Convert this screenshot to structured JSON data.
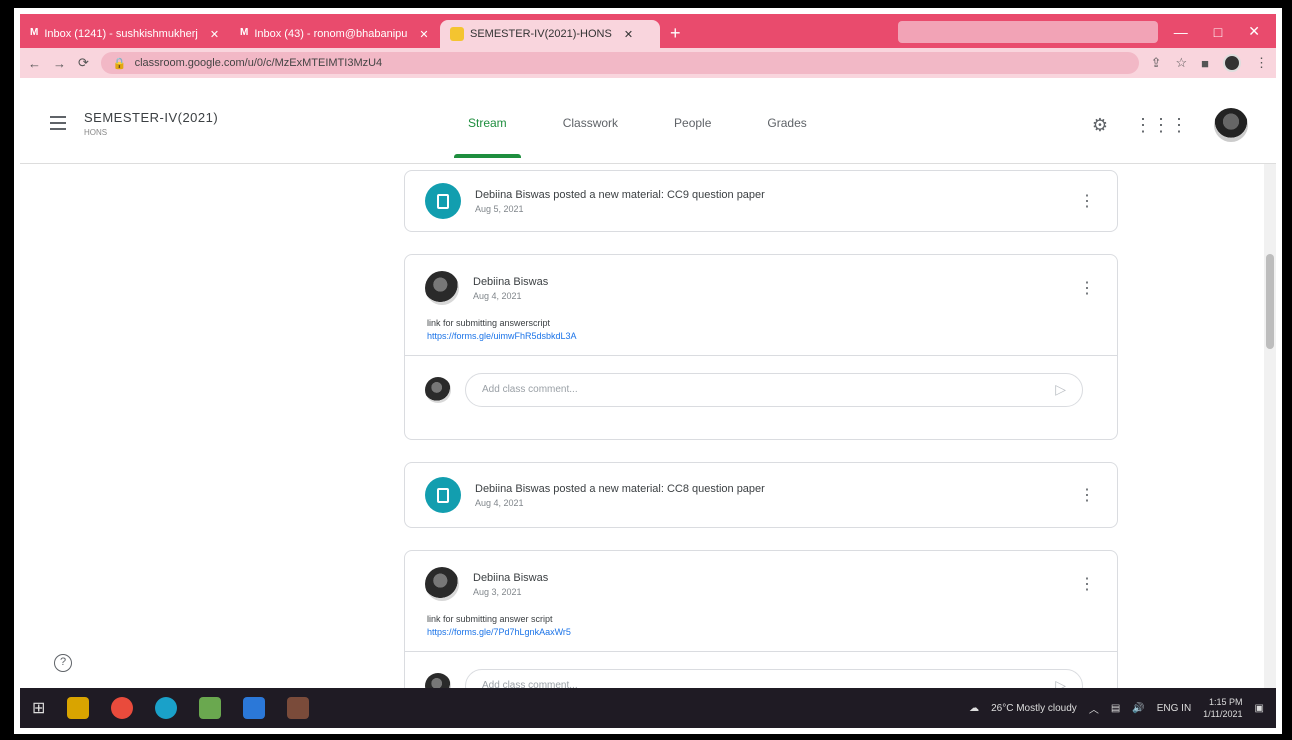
{
  "browser": {
    "tabs": [
      {
        "label": "Inbox (1241) - sushkishmukherj",
        "icon": "gmail-icon",
        "active": false
      },
      {
        "label": "Inbox (43) - ronom@bhabanipu",
        "icon": "gmail-icon",
        "active": false
      },
      {
        "label": "SEMESTER-IV(2021)-HONS",
        "icon": "classroom-icon",
        "active": true
      }
    ],
    "new_tab_label": "+",
    "url": "classroom.google.com/u/0/c/MzExMTEIMTI3MzU4",
    "window_controls": [
      "—",
      "□",
      "✕"
    ]
  },
  "header": {
    "class_name": "SEMESTER-IV(2021)",
    "class_section": "HONS",
    "tabs": [
      {
        "label": "Stream",
        "active": true
      },
      {
        "label": "Classwork",
        "active": false
      },
      {
        "label": "People",
        "active": false
      },
      {
        "label": "Grades",
        "active": false
      }
    ]
  },
  "stream": {
    "material_1": {
      "title": "Debiina Biswas posted a new material: CC9 question paper",
      "date": "Aug 5, 2021"
    },
    "post_1": {
      "author": "Debiina Biswas",
      "date": "Aug 4, 2021",
      "body": "link for submitting answerscript",
      "link": "https://forms.gle/uimwFhR5dsbkdL3A"
    },
    "comment_placeholder": "Add class comment...",
    "material_2": {
      "title": "Debiina Biswas posted a new material: CC8 question paper",
      "date": "Aug 4, 2021"
    },
    "post_2": {
      "author": "Debiina Biswas",
      "date": "Aug 3, 2021",
      "body": "link for submitting answer script",
      "link": "https://forms.gle/7Pd7hLgnkAaxWr5"
    }
  },
  "taskbar": {
    "weather": "26°C Mostly cloudy",
    "lang": "ENG IN",
    "time": "1:15 PM",
    "date": "1/11/2021"
  }
}
